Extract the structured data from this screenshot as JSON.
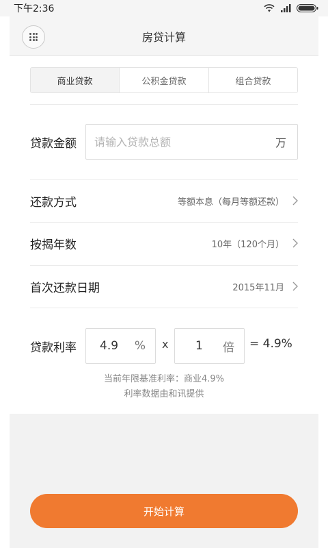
{
  "status_bar": {
    "time": "下午2:36",
    "icons": [
      "wifi-icon",
      "signal-icon",
      "battery-icon"
    ]
  },
  "header": {
    "title": "房贷计算",
    "menu_icon": "grid-icon"
  },
  "tabs": [
    {
      "label": "商业贷款",
      "active": true
    },
    {
      "label": "公积金贷款",
      "active": false
    },
    {
      "label": "组合贷款",
      "active": false
    }
  ],
  "loan_amount": {
    "label": "贷款金额",
    "placeholder": "请输入贷款总额",
    "value": "",
    "unit": "万"
  },
  "options": {
    "repayment_method": {
      "label": "还款方式",
      "value": "等额本息（每月等额还款）"
    },
    "loan_years": {
      "label": "按揭年数",
      "value": "10年（120个月）"
    },
    "first_payment_date": {
      "label": "首次还款日期",
      "value": "2015年11月"
    }
  },
  "rate": {
    "label": "贷款利率",
    "base_value": "4.9",
    "base_unit": "%",
    "times_sign": "x",
    "multiplier_value": "1",
    "multiplier_unit": "倍",
    "result": "= 4.9%",
    "note_line1": "当前年限基准利率：商业4.9%",
    "note_line2": "利率数据由和讯提供"
  },
  "start_button": {
    "label": "开始计算"
  },
  "colors": {
    "accent": "#f07a30",
    "header_bg": "#f5f5f5",
    "page_bg": "#f2f2f2"
  }
}
